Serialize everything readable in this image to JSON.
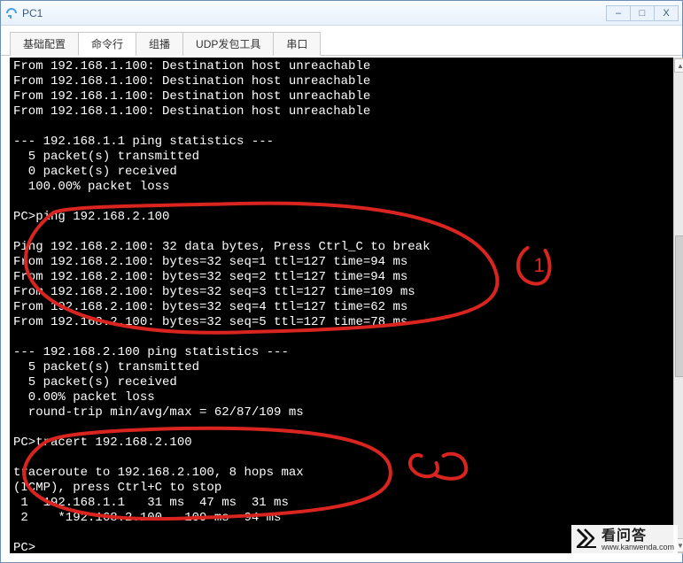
{
  "window": {
    "title": "PC1",
    "controls": {
      "min": "–",
      "max": "□",
      "close": "X"
    }
  },
  "tabs": [
    {
      "label": "基础配置",
      "active": false
    },
    {
      "label": "命令行",
      "active": true
    },
    {
      "label": "组播",
      "active": false
    },
    {
      "label": "UDP发包工具",
      "active": false
    },
    {
      "label": "串口",
      "active": false
    }
  ],
  "terminal": {
    "lines": [
      "From 192.168.1.100: Destination host unreachable",
      "From 192.168.1.100: Destination host unreachable",
      "From 192.168.1.100: Destination host unreachable",
      "From 192.168.1.100: Destination host unreachable",
      "",
      "--- 192.168.1.1 ping statistics ---",
      "  5 packet(s) transmitted",
      "  0 packet(s) received",
      "  100.00% packet loss",
      "",
      "PC>ping 192.168.2.100",
      "",
      "Ping 192.168.2.100: 32 data bytes, Press Ctrl_C to break",
      "From 192.168.2.100: bytes=32 seq=1 ttl=127 time=94 ms",
      "From 192.168.2.100: bytes=32 seq=2 ttl=127 time=94 ms",
      "From 192.168.2.100: bytes=32 seq=3 ttl=127 time=109 ms",
      "From 192.168.2.100: bytes=32 seq=4 ttl=127 time=62 ms",
      "From 192.168.2.100: bytes=32 seq=5 ttl=127 time=78 ms",
      "",
      "--- 192.168.2.100 ping statistics ---",
      "  5 packet(s) transmitted",
      "  5 packet(s) received",
      "  0.00% packet loss",
      "  round-trip min/avg/max = 62/87/109 ms",
      "",
      "PC>tracert 192.168.2.100",
      "",
      "traceroute to 192.168.2.100, 8 hops max",
      "(ICMP), press Ctrl+C to stop",
      " 1  192.168.1.1   31 ms  47 ms  31 ms",
      " 2    *192.168.2.100   109 ms  94 ms",
      "",
      "PC>"
    ]
  },
  "annotations": {
    "label1": "1",
    "label2": "2"
  },
  "watermark": {
    "cn": "看问答",
    "url": "www.kanwenda.com"
  },
  "colors": {
    "annotation": "#d9241f",
    "terminal_bg": "#000000",
    "terminal_fg": "#ffffff"
  }
}
